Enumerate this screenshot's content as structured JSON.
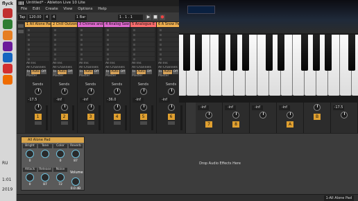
{
  "taskbar": {
    "logo": "flyck",
    "bottom_labels": [
      "RU",
      "1:01",
      "2019"
    ],
    "app_colors": [
      "#c03030",
      "#2e7d32",
      "#e67e22",
      "#6a1b9a",
      "#1565c0",
      "#d32f2f",
      "#ef6c00",
      "#00897b",
      "#8e24aa",
      "#607d8b"
    ]
  },
  "window": {
    "title": "Untitled* - Ableton Live 10 Lite"
  },
  "menu": [
    "File",
    "Edit",
    "Create",
    "View",
    "Options",
    "Help"
  ],
  "transport": {
    "tap": "Tap",
    "tempo": "120.00",
    "sig_num": "4",
    "sig_den": "4",
    "metronome": "1 Bar",
    "position": "1 . 1 . 1"
  },
  "tracks": [
    {
      "name": "1 All Alone Pad",
      "color": "#f0b050"
    },
    {
      "name": "2 Chill Outzone",
      "color": "#f0b050"
    },
    {
      "name": "3 Chimes and",
      "color": "#e06ad0"
    },
    {
      "name": "4 Analog Saw",
      "color": "#e06ad0"
    },
    {
      "name": "5 Analogue E",
      "color": "#ff6f6f"
    },
    {
      "name": "6 A Snow Pad",
      "color": "#f0b050"
    }
  ],
  "io": {
    "in_label": "All Ins",
    "channels": "All Channels",
    "monitor": [
      "In",
      "Auto",
      "Off"
    ],
    "out": "Master",
    "sends": "Sends"
  },
  "mixer": {
    "volumes": [
      "-17.5",
      "-inf",
      "-inf",
      "-36.0",
      "-inf",
      "-inf"
    ],
    "numbers": [
      "1",
      "2",
      "3",
      "4",
      "5",
      "6"
    ]
  },
  "right_mixer": {
    "volumes": [
      "-inf",
      "-inf",
      "-inf",
      "-inf",
      "-17.5"
    ],
    "numbers": [
      "7",
      "8",
      "A",
      "B"
    ]
  },
  "device": {
    "name": "All Alone Pad",
    "macros_top": [
      {
        "label": "Bright",
        "value": "0"
      },
      {
        "label": "Tone",
        "value": ""
      },
      {
        "label": "Color",
        "value": "0"
      },
      {
        "label": "Reverb",
        "value": "87"
      }
    ],
    "macros_bottom": [
      {
        "label": "Attack",
        "value": "0"
      },
      {
        "label": "Release",
        "value": "87"
      },
      {
        "label": "Noise",
        "value": "72"
      },
      {
        "label": "",
        "value": "0.0 dB"
      }
    ],
    "volume_label": "Volume",
    "accent": "#6fc3e0"
  },
  "drop_text": "Drop Audio Effects Here",
  "status": {
    "track_indicator": "1-All Alone Pad"
  }
}
